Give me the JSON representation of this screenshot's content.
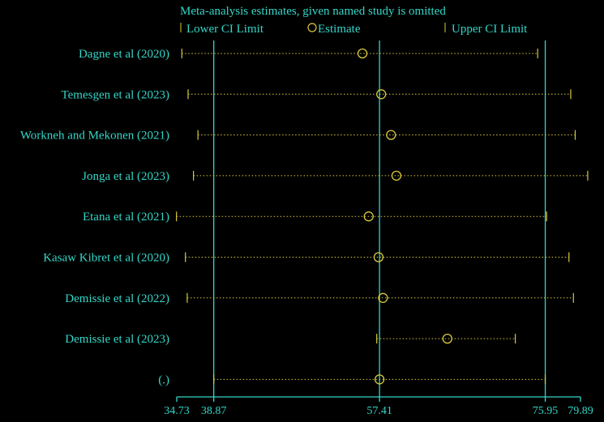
{
  "chart_data": {
    "type": "forest",
    "title": "Meta-analysis estimates, given named study is omitted",
    "legend": {
      "lower": "Lower CI Limit",
      "estimate": "Estimate",
      "upper": "Upper CI Limit"
    },
    "xlim": [
      34.73,
      79.89
    ],
    "x_ticks": [
      34.73,
      38.87,
      57.41,
      75.95,
      79.89
    ],
    "x_tick_labels": [
      "34.73",
      "38.87",
      "57.41",
      "75.95",
      "79.89"
    ],
    "reference_lines": [
      38.87,
      57.41,
      75.95
    ],
    "studies": [
      {
        "label": "Dagne et al (2020)",
        "lower": 35.3,
        "estimate": 55.5,
        "upper": 75.1
      },
      {
        "label": "Temesgen et al (2023)",
        "lower": 36.0,
        "estimate": 57.6,
        "upper": 78.8
      },
      {
        "label": "Workneh and Mekonen (2021)",
        "lower": 37.1,
        "estimate": 58.7,
        "upper": 79.3
      },
      {
        "label": "Jonga  et al (2023)",
        "lower": 36.6,
        "estimate": 59.3,
        "upper": 80.7
      },
      {
        "label": "Etana et al (2021)",
        "lower": 34.7,
        "estimate": 56.2,
        "upper": 76.1
      },
      {
        "label": "Kasaw Kibret et al (2020)",
        "lower": 35.7,
        "estimate": 57.3,
        "upper": 78.6
      },
      {
        "label": "Demissie et al (2022)",
        "lower": 35.9,
        "estimate": 57.8,
        "upper": 79.1
      },
      {
        "label": "Demissie et al (2023)",
        "lower": 57.1,
        "estimate": 65.0,
        "upper": 72.6
      },
      {
        "label": "(.)",
        "lower": 38.87,
        "estimate": 57.41,
        "upper": 75.95
      }
    ],
    "colors": {
      "text": "#33d6c8",
      "marker": "#d9c93a",
      "ref_line": "#33d6c8",
      "background": "#000000"
    }
  }
}
